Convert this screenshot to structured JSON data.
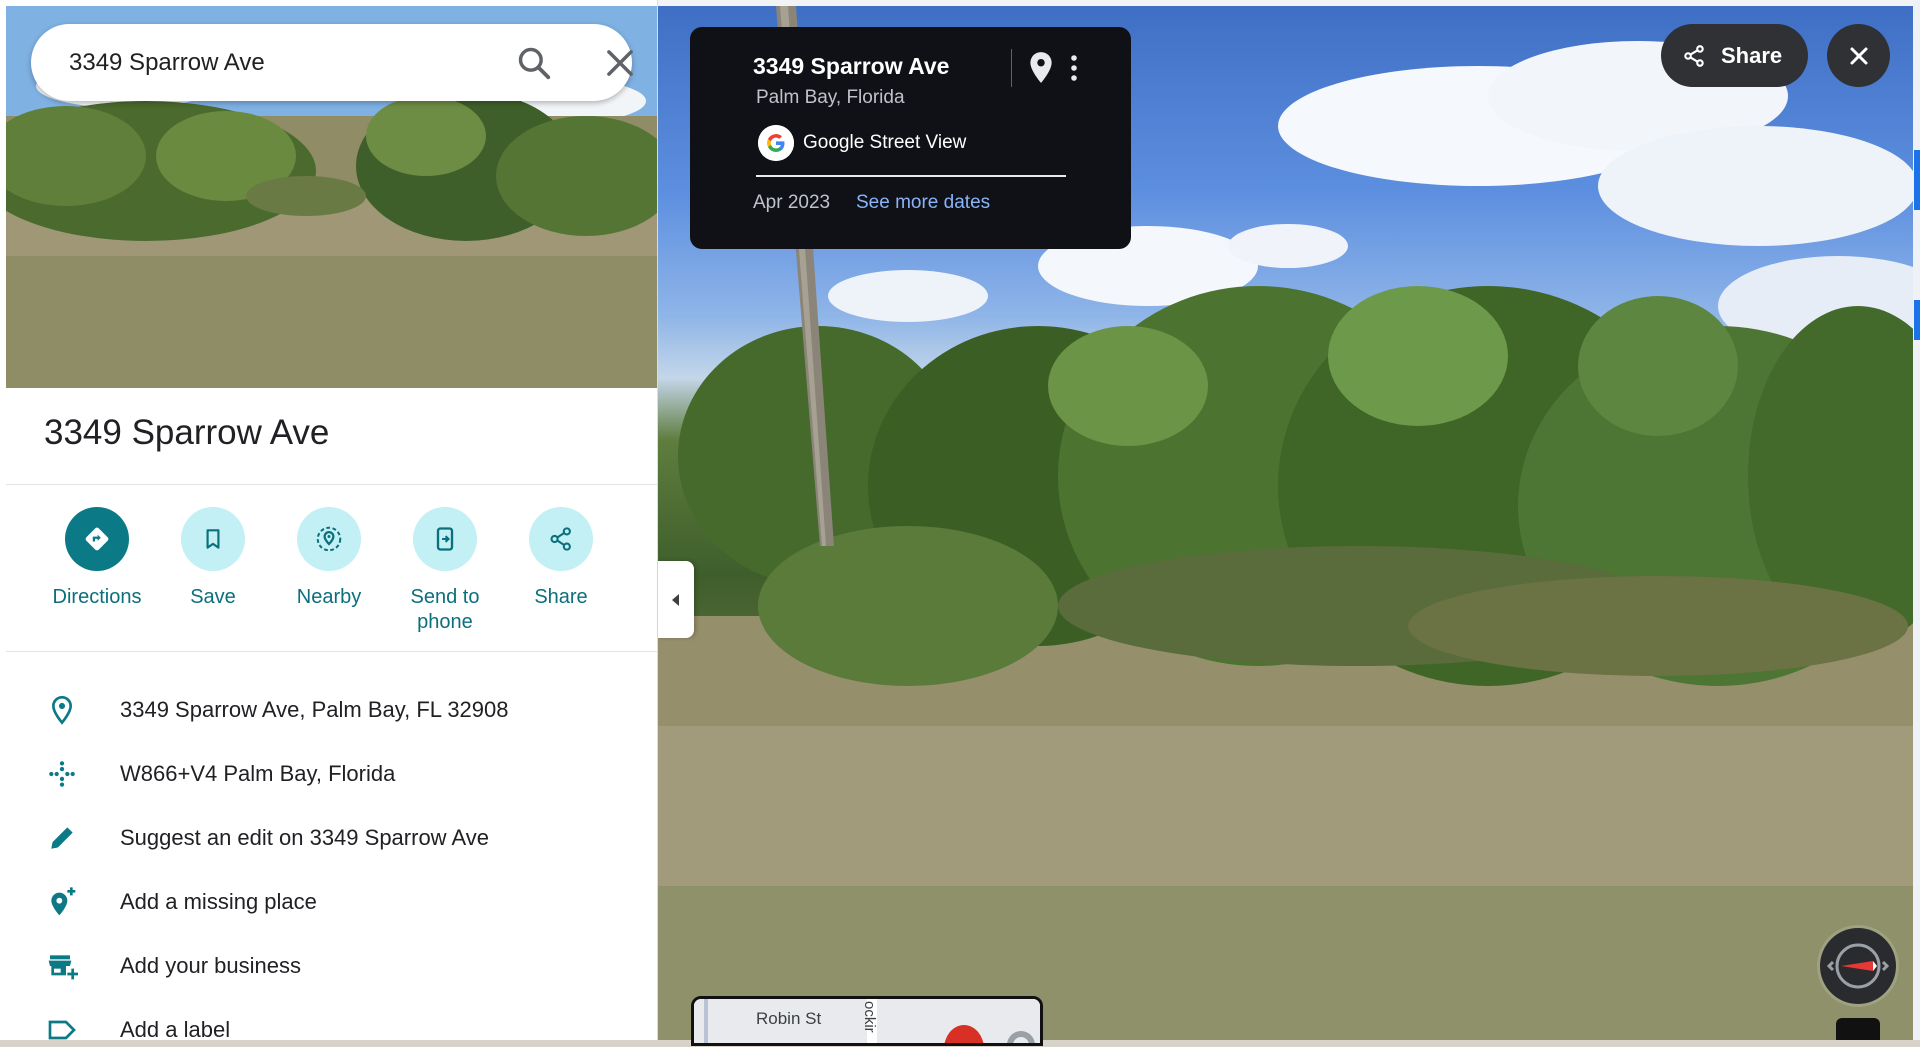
{
  "search": {
    "value": "3349 Sparrow Ave",
    "search_icon": "search-icon",
    "clear_icon": "close-icon"
  },
  "place": {
    "title": "3349 Sparrow Ave"
  },
  "actions": [
    {
      "label": "Directions",
      "icon": "directions-icon"
    },
    {
      "label": "Save",
      "icon": "bookmark-icon"
    },
    {
      "label": "Nearby",
      "icon": "nearby-icon"
    },
    {
      "label": "Send to\nphone",
      "icon": "send-to-phone-icon"
    },
    {
      "label": "Share",
      "icon": "share-icon"
    }
  ],
  "info_rows": [
    {
      "text": "3349 Sparrow Ave, Palm Bay, FL 32908",
      "icon": "location-pin-icon"
    },
    {
      "text": "W866+V4 Palm Bay, Florida",
      "icon": "plus-code-icon"
    },
    {
      "text": "Suggest an edit on 3349 Sparrow Ave",
      "icon": "pencil-icon"
    },
    {
      "text": "Add a missing place",
      "icon": "add-place-icon"
    },
    {
      "text": "Add your business",
      "icon": "add-business-icon"
    },
    {
      "text": "Add a label",
      "icon": "label-icon"
    }
  ],
  "street_card": {
    "title": "3349 Sparrow Ave",
    "subtitle": "Palm Bay, Florida",
    "source": "Google Street View",
    "date": "Apr 2023",
    "more_dates": "See more dates"
  },
  "viewer": {
    "share_label": "Share"
  },
  "minimap": {
    "street_label": "Robin St",
    "side_label": "ockir"
  },
  "colors": {
    "accent": "#0b7a86",
    "accent_light": "#c2f0f4",
    "link": "#8ab4f8",
    "card_bg": "#0f1116"
  }
}
